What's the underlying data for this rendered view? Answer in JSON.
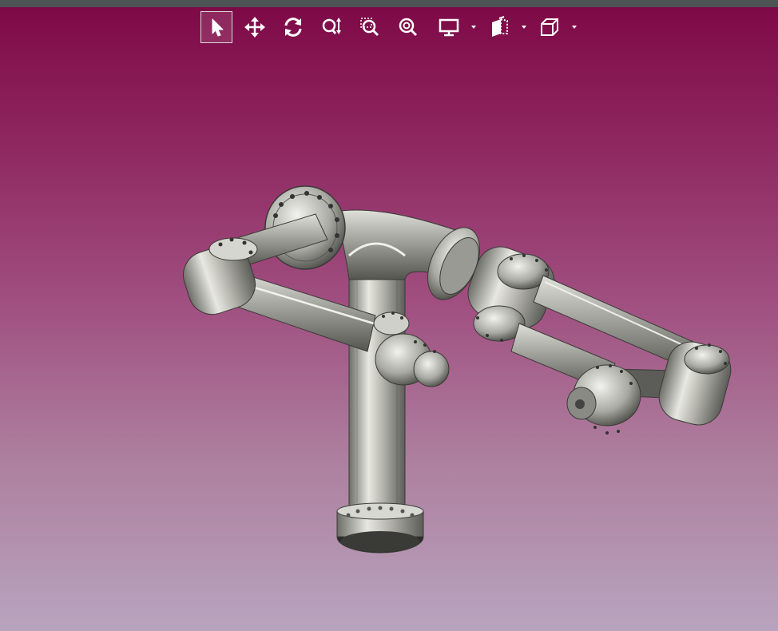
{
  "window": {
    "title": ""
  },
  "toolbar": {
    "items": [
      {
        "name": "select-tool",
        "icon": "cursor-arrow-icon",
        "active": true
      },
      {
        "name": "pan-tool",
        "icon": "four-way-arrows-icon",
        "active": false
      },
      {
        "name": "rotate-tool",
        "icon": "rotate-arrows-icon",
        "active": false
      },
      {
        "name": "zoom-tool",
        "icon": "zoom-updown-icon",
        "active": false
      },
      {
        "name": "zoom-window-tool",
        "icon": "zoom-window-icon",
        "active": false
      },
      {
        "name": "zoom-fit-tool",
        "icon": "zoom-fit-icon",
        "active": false
      },
      {
        "name": "display-mode-menu",
        "icon": "monitor-icon",
        "has_dropdown": true
      },
      {
        "name": "section-view-menu",
        "icon": "section-plane-icon",
        "has_dropdown": true
      },
      {
        "name": "view-orientation-menu",
        "icon": "cube-view-icon",
        "has_dropdown": true
      }
    ]
  },
  "colors": {
    "background_top": "#7d0845",
    "background_bottom": "#b8a4be",
    "toolbar_icon": "#ffffff",
    "top_strip": "#4d5253",
    "model_metal": "#c8c8c0"
  },
  "model": {
    "description_icon": "robot-arm-pipe-assembly"
  }
}
